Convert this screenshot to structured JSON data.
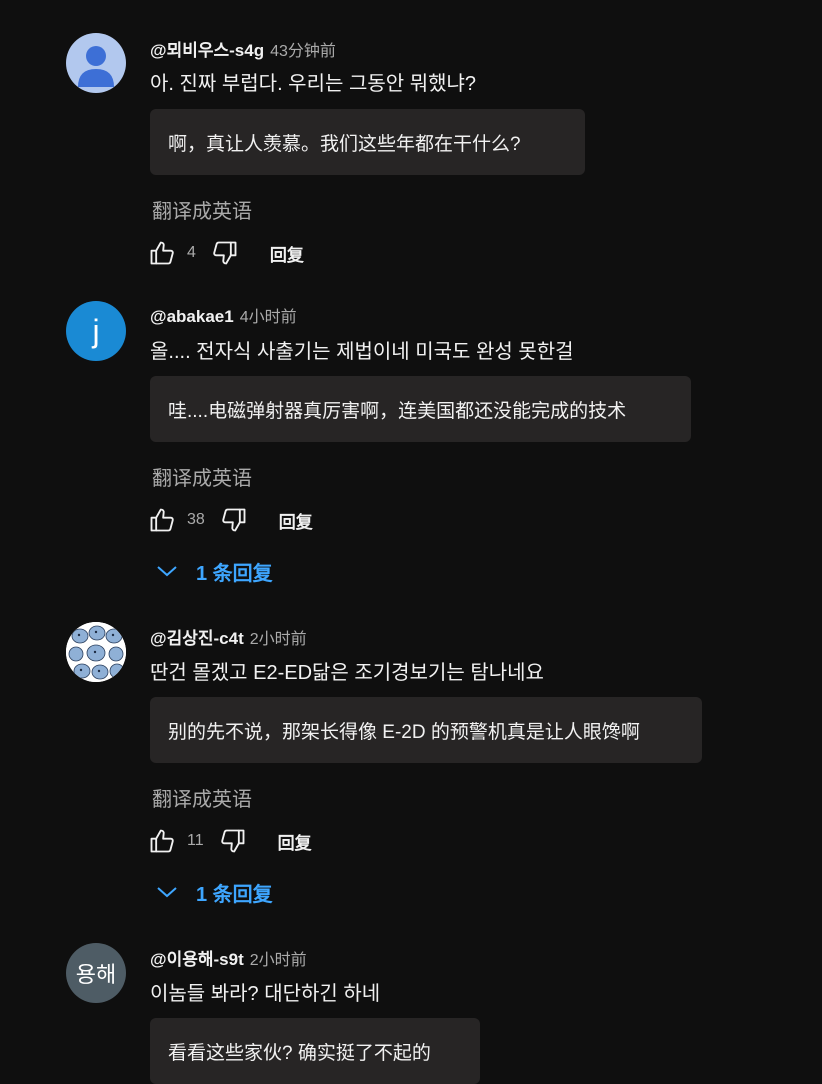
{
  "comments": [
    {
      "author": "@뫼비우스-s4g",
      "time": "43分钟前",
      "text": "아. 진짜 부럽다. 우리는 그동안 뭐했냐?",
      "translation": "啊，真让人羡慕。我们这些年都在干什么?",
      "translate_label": "翻译成英语",
      "likes": "4",
      "reply_label": "回复",
      "avatar": "default-user-icon"
    },
    {
      "author": "@abakae1",
      "time": "4小时前",
      "text": "올.... 전자식 사출기는 제법이네 미국도 완성 못한걸",
      "translation": "哇....电磁弹射器真厉害啊，连美国都还没能完成的技术",
      "translate_label": "翻译成英语",
      "likes": "38",
      "reply_label": "回复",
      "avatar_letter": "j",
      "replies_label": "1 条回复"
    },
    {
      "author": "@김상진-c4t",
      "time": "2小时前",
      "text": "딴건 몰겠고 E2-ED닮은 조기경보기는 탐나네요",
      "translation": "别的先不说，那架长得像 E-2D 的预警机真是让人眼馋啊",
      "translate_label": "翻译成英语",
      "likes": "11",
      "reply_label": "回复",
      "avatar": "elephant-pattern-avatar",
      "replies_label": "1 条回复"
    },
    {
      "author": "@이용해-s9t",
      "time": "2小时前",
      "text": "이놈들 봐라? 대단하긴 하네",
      "translation": "看看这些家伙? 确实挺了不起的",
      "avatar_text": "용해"
    }
  ],
  "colors": {
    "background": "#0f0f0f",
    "translation_box": "#272525",
    "link_blue": "#3ea6ff",
    "muted": "#aaaaaa"
  }
}
